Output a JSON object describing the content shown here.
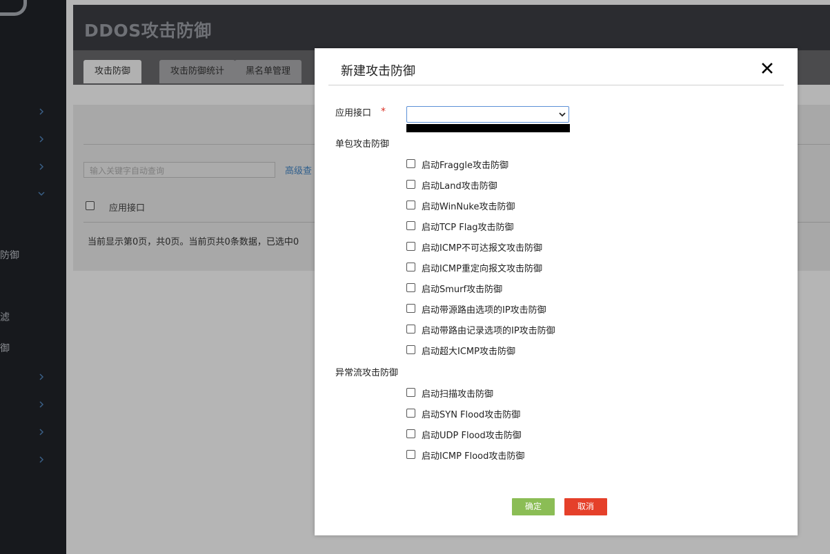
{
  "page": {
    "title": "DDOS攻击防御",
    "tabs": [
      "攻击防御",
      "攻击防御统计",
      "黑名单管理"
    ],
    "search_placeholder": "输入关键字自动查询",
    "advanced_search": "高级查",
    "column_header": "应用接口",
    "status_text": "当前显示第0页，共0页。当前页共0条数据，已选中0"
  },
  "sidebar": {
    "items": [
      "防御",
      "滤",
      "御"
    ]
  },
  "modal": {
    "title": "新建攻击防御",
    "interface_label": "应用接口",
    "required_mark": "*",
    "interface_value": "",
    "single_packet_label": "单包攻击防御",
    "single_packet_options": [
      "启动Fraggle攻击防御",
      "启动Land攻击防御",
      "启动WinNuke攻击防御",
      "启动TCP Flag攻击防御",
      "启动ICMP不可达报文攻击防御",
      "启动ICMP重定向报文攻击防御",
      "启动Smurf攻击防御",
      "启动带源路由选项的IP攻击防御",
      "启动带路由记录选项的IP攻击防御",
      "启动超大ICMP攻击防御"
    ],
    "abnormal_flow_label": "异常流攻击防御",
    "abnormal_flow_options": [
      "启动扫描攻击防御",
      "启动SYN Flood攻击防御",
      "启动UDP Flood攻击防御",
      "启动ICMP Flood攻击防御"
    ],
    "ok_label": "确定",
    "cancel_label": "取消"
  },
  "colors": {
    "ok_button": "#8bbd55",
    "cancel_button": "#e5402a",
    "required": "#d93025",
    "link": "#2f5f8d"
  },
  "icons": [
    "close-icon",
    "chevron-down-icon",
    "chevron-right-icon"
  ]
}
